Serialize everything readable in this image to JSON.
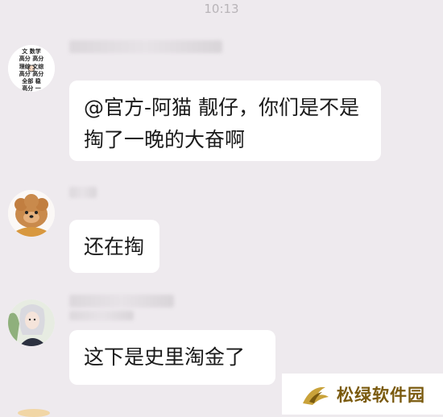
{
  "status": {
    "time": "10:13"
  },
  "messages": [
    {
      "sender_avatar": "text-collage-avatar",
      "lines": [
        "@官方-阿猫 靓仔，你们是不是",
        "掏了一晚的大奋啊"
      ]
    },
    {
      "sender_avatar": "puppy-avatar",
      "lines": [
        "还在掏"
      ]
    },
    {
      "sender_avatar": "anime-girl-avatar",
      "lines": [
        "这下是史里淘金了"
      ]
    }
  ],
  "avatar1_text": {
    "row1": "文 数学",
    "row2": "高分 高分",
    "row3": "理综 文综",
    "row4": "高分 高分",
    "row5": "全部 稳",
    "row6": "高分 一"
  },
  "watermark": {
    "text": "松绿软件园",
    "color": "#7a5a0e"
  },
  "colors": {
    "background": "#eeeaee",
    "bubble": "#ffffff",
    "text": "#1a1a1a"
  }
}
